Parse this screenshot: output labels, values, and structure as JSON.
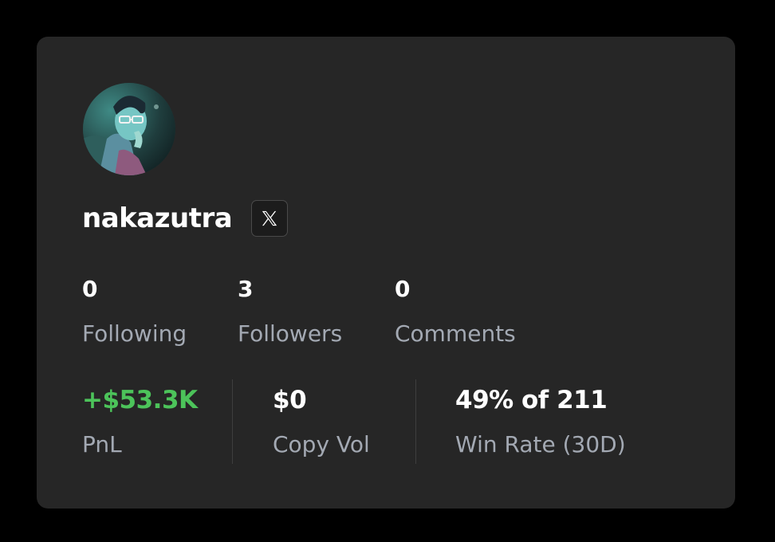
{
  "profile": {
    "username": "nakazutra",
    "avatar_icon": "user-avatar-image",
    "social_icon": "x-logo-icon"
  },
  "stats": [
    {
      "value": "0",
      "label": "Following"
    },
    {
      "value": "3",
      "label": "Followers"
    },
    {
      "value": "0",
      "label": "Comments"
    }
  ],
  "metrics": [
    {
      "value": "+$53.3K",
      "label": "PnL",
      "color": "#4cc35a"
    },
    {
      "value": "$0",
      "label": "Copy Vol",
      "color": "#ffffff"
    },
    {
      "value": "49% of 211",
      "label": "Win Rate (30D)",
      "color": "#ffffff"
    }
  ],
  "colors": {
    "background": "#000000",
    "card": "#262626",
    "muted_text": "#a3a9b3",
    "positive": "#4cc35a"
  }
}
